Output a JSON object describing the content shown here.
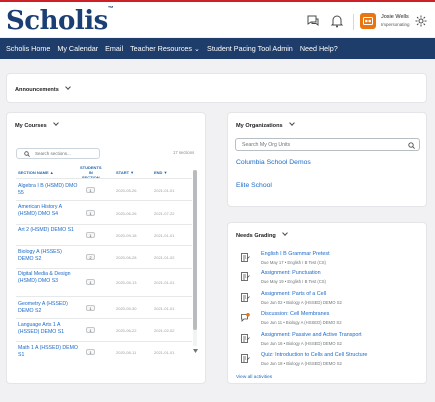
{
  "header": {
    "logo": "Scholis",
    "logo_tm": "™",
    "user_name": "Josie Wells",
    "user_sub": "Impersonating",
    "icons": [
      "messages-icon",
      "bell-icon",
      "gear-icon"
    ]
  },
  "nav": {
    "items": [
      "Scholis Home",
      "My Calendar",
      "Email",
      "Teacher Resources ⌄",
      "Student Pacing Tool Admin",
      "Need Help?"
    ]
  },
  "announcements": {
    "title": "Announcements"
  },
  "courses": {
    "title": "My Courses",
    "search_placeholder": "Search sections...",
    "count": "17 sections",
    "columns": [
      "SECTION NAME ▲",
      "STUDENTS\nIN\nSECTION",
      "START ▼",
      "END ▼"
    ],
    "rows": [
      {
        "name": "Algebra I B (HSMD) DMO 55",
        "students": "1",
        "start": "2020-05-26",
        "end": "2021-01-01"
      },
      {
        "name": "American History A (HSMD) DMO S4",
        "students": "1",
        "start": "2020-06-26",
        "end": "2021-07-22"
      },
      {
        "name": "Art 2 (HSMD) DEMO S1",
        "students": "1",
        "start": "2020-09-18",
        "end": "2021-01-01"
      },
      {
        "name": "Biology A (HSSES) DEMO S2",
        "students": "2",
        "start": "2020-06-28",
        "end": "2021-01-02"
      },
      {
        "name": "Digital Media & Design (HSMD) DMO S3",
        "students": "1",
        "start": "2020-05-13",
        "end": "2021-01-01"
      },
      {
        "name": "Geometry A (HSSED) DEMO S2",
        "students": "1",
        "start": "2020-05-30",
        "end": "2021-01-01"
      },
      {
        "name": "Language Arts 1 A (HSSED) DEMO S1",
        "students": "1",
        "start": "2020-06-22",
        "end": "2021-02-02"
      },
      {
        "name": "Math 1 A (HSSED) DEMO S1",
        "students": "1",
        "start": "2020-08-11",
        "end": "2021-01-01"
      }
    ]
  },
  "orgs": {
    "title": "My Organizations",
    "search_placeholder": "Search My Org Units",
    "items": [
      "Columbia School Demos",
      "Elite School"
    ]
  },
  "grading": {
    "title": "Needs Grading",
    "items": [
      {
        "title": "English I B Grammar Pretest",
        "sub": "Due May 17 • English I B Test (CS)"
      },
      {
        "title": "Assignment: Punctuation",
        "sub": "Due May 19 • English I B Test (CS)"
      },
      {
        "title": "Assignment: Parts of a Cell",
        "sub": "Due Jun 02 • Biology A (HSSED) DEMO S2"
      },
      {
        "title": "Discussion: Cell Membranes",
        "sub": "Due Jun 11 • Biology A (HSSED) DEMO S2"
      },
      {
        "title": "Assignment: Passive and Active Transport",
        "sub": "Due Jun 16 • Biology A (HSSED) DEMO S2"
      },
      {
        "title": "Quiz: Introduction to Cells and Cell Structure",
        "sub": "Due Jun 18 • Biology A (HSSED) DEMO S2"
      }
    ],
    "view_all": "View all activities"
  },
  "colors": {
    "nav_bg": "#1f3d6a",
    "link": "#1b6ac9",
    "accent": "#e87511",
    "stripe": "#cd2026"
  }
}
